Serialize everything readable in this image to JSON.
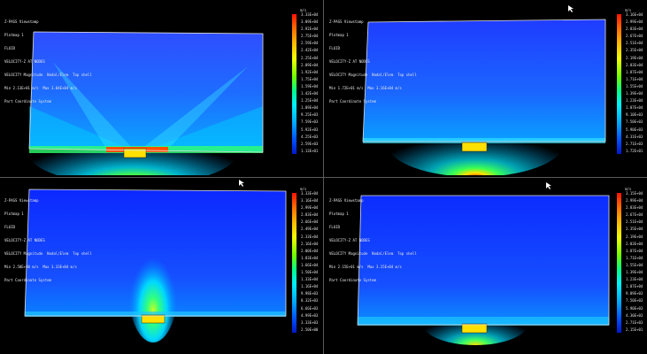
{
  "viewports": [
    {
      "id": "top-left",
      "info_lines": [
        "Z-PASS Viewstamp",
        "Plotmap 1",
        "FLUID",
        "VELOCITY-Z AT NODES",
        "VELOCITY Magnitude  Nodal/Elem  Top shell",
        "Min 2.13E+01 m/s  Max 3.04E+04 m/s",
        "Part Coordinate System"
      ],
      "legend_unit": "m/s",
      "legend_ticks": [
        "3.33E+04",
        "3.09E+04",
        "2.92E+04",
        "2.75E+04",
        "2.59E+04",
        "2.42E+04",
        "2.25E+04",
        "2.09E+04",
        "1.92E+04",
        "1.75E+04",
        "1.59E+04",
        "1.42E+04",
        "1.25E+04",
        "1.09E+04",
        "9.25E+03",
        "7.59E+03",
        "5.92E+03",
        "4.25E+03",
        "2.59E+03",
        "1.13E+01"
      ]
    },
    {
      "id": "top-right",
      "info_lines": [
        "Z-PASS Viewstamp",
        "Plotmap 1",
        "FLUID",
        "VELOCITY-Z AT NODES",
        "VELOCITY Magnitude  Nodal/Elem  Top shell",
        "Min 1.72E+01 m/s  Max 3.16E+04 m/s",
        "Part Coordinate System"
      ],
      "legend_unit": "m/s",
      "legend_ticks": [
        "3.16E+04",
        "2.99E+04",
        "2.83E+04",
        "2.67E+04",
        "2.51E+04",
        "2.35E+04",
        "2.19E+04",
        "2.03E+04",
        "1.87E+04",
        "1.71E+04",
        "1.55E+04",
        "1.39E+04",
        "1.23E+04",
        "1.07E+04",
        "9.10E+03",
        "7.50E+03",
        "5.90E+03",
        "4.31E+03",
        "2.71E+03",
        "1.72E+01"
      ]
    },
    {
      "id": "bottom-left",
      "info_lines": [
        "Z-PASS Viewstamp",
        "Plotmap 1",
        "FLUID",
        "VELOCITY-Z AT NODES",
        "VELOCITY Magnitude  Nodal/Elem  Top shell",
        "Min 2.50E+00 m/s  Max 3.33E+04 m/s",
        "Part Coordinate System"
      ],
      "legend_unit": "m/s",
      "legend_ticks": [
        "3.33E+04",
        "3.16E+04",
        "2.99E+04",
        "2.83E+04",
        "2.66E+04",
        "2.49E+04",
        "2.33E+04",
        "2.16E+04",
        "2.00E+04",
        "1.83E+04",
        "1.66E+04",
        "1.50E+04",
        "1.33E+04",
        "1.16E+04",
        "9.98E+03",
        "8.32E+03",
        "6.66E+03",
        "4.99E+03",
        "3.33E+03",
        "2.50E+00"
      ]
    },
    {
      "id": "bottom-right",
      "info_lines": [
        "Z-PASS Viewstamp",
        "Plotmap 1",
        "FLUID",
        "VELOCITY-Z AT NODES",
        "VELOCITY Magnitude  Nodal/Elem  Top shell",
        "Min 2.15E+01 m/s  Max 3.15E+04 m/s",
        "Part Coordinate System"
      ],
      "legend_unit": "m/s",
      "legend_ticks": [
        "3.15E+04",
        "2.99E+04",
        "2.83E+04",
        "2.67E+04",
        "2.51E+04",
        "2.35E+04",
        "2.19E+04",
        "2.03E+04",
        "1.87E+04",
        "1.71E+04",
        "1.55E+04",
        "1.39E+04",
        "1.23E+04",
        "1.07E+04",
        "9.09E+03",
        "7.50E+03",
        "5.90E+03",
        "4.30E+03",
        "2.71E+03",
        "2.15E+01"
      ]
    }
  ],
  "colors": {
    "background": "#000000",
    "panel_border": "#5a5a5a",
    "field_low": "#0a30ff",
    "field_mid": "#00c8ff",
    "field_high": "#ff2000"
  }
}
